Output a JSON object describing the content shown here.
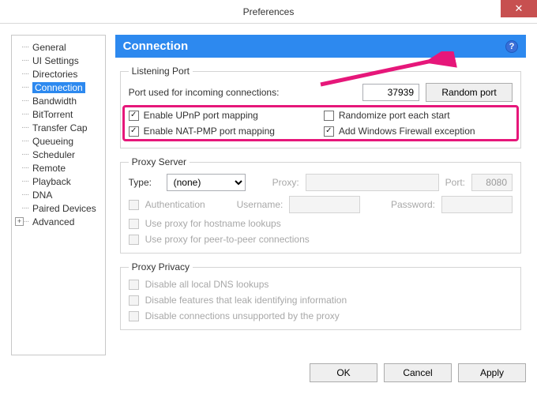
{
  "window": {
    "title": "Preferences",
    "close_glyph": "✕"
  },
  "tree": {
    "items": [
      {
        "label": "General"
      },
      {
        "label": "UI Settings"
      },
      {
        "label": "Directories"
      },
      {
        "label": "Connection",
        "selected": true
      },
      {
        "label": "Bandwidth"
      },
      {
        "label": "BitTorrent"
      },
      {
        "label": "Transfer Cap"
      },
      {
        "label": "Queueing"
      },
      {
        "label": "Scheduler"
      },
      {
        "label": "Remote"
      },
      {
        "label": "Playback"
      },
      {
        "label": "DNA"
      },
      {
        "label": "Paired Devices"
      },
      {
        "label": "Advanced",
        "expandable": true
      }
    ]
  },
  "section": {
    "title": "Connection",
    "help_glyph": "?"
  },
  "listening": {
    "legend": "Listening Port",
    "port_label": "Port used for incoming connections:",
    "port_value": "37939",
    "random_btn": "Random port",
    "upnp": "Enable UPnP port mapping",
    "natpmp": "Enable NAT-PMP port mapping",
    "randomize": "Randomize port each start",
    "firewall": "Add Windows Firewall exception"
  },
  "proxy": {
    "legend": "Proxy Server",
    "type_label": "Type:",
    "type_value": "(none)",
    "proxy_label": "Proxy:",
    "port_label": "Port:",
    "port_value": "8080",
    "auth": "Authentication",
    "user_label": "Username:",
    "pass_label": "Password:",
    "hostname": "Use proxy for hostname lookups",
    "p2p": "Use proxy for peer-to-peer connections"
  },
  "privacy": {
    "legend": "Proxy Privacy",
    "dns": "Disable all local DNS lookups",
    "leak": "Disable features that leak identifying information",
    "unsupported": "Disable connections unsupported by the proxy"
  },
  "footer": {
    "ok": "OK",
    "cancel": "Cancel",
    "apply": "Apply"
  },
  "checkmark": "✓"
}
